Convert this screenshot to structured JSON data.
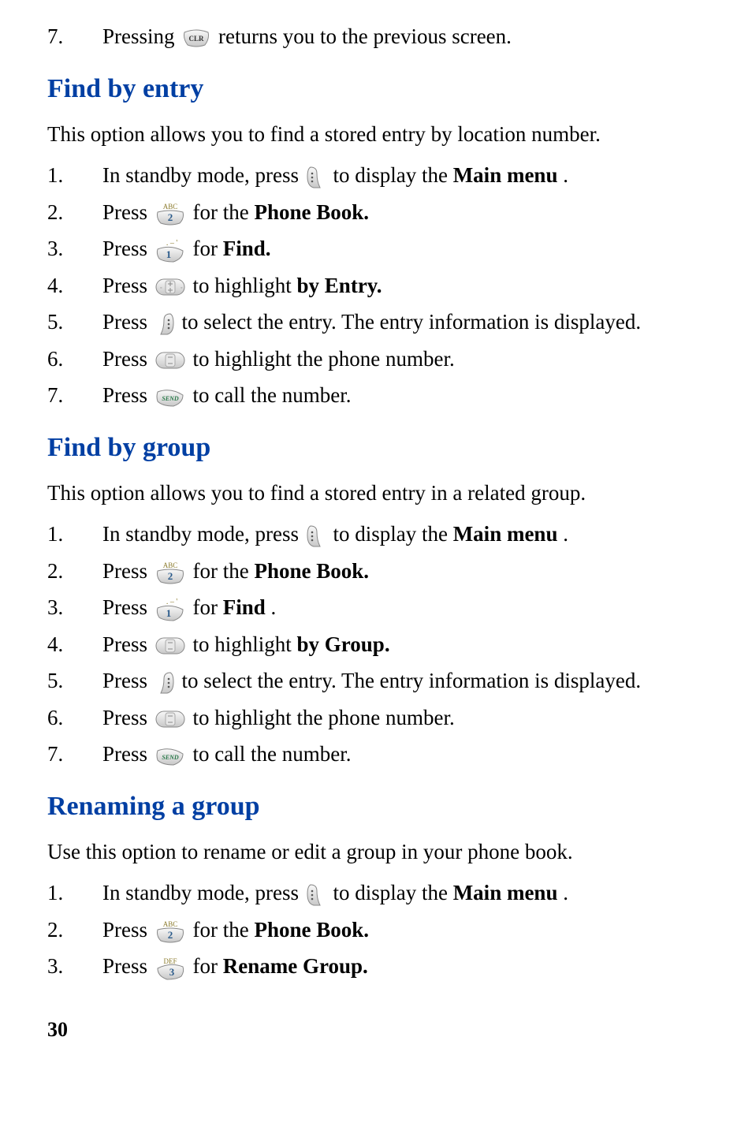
{
  "top_item": {
    "num": "7.",
    "t1": "Pressing ",
    "t2": " returns you to the previous screen."
  },
  "sections": {
    "findByEntry": {
      "heading": "Find by entry",
      "intro": "This option allows you to find a stored entry by location number.",
      "steps": [
        {
          "num": "1.",
          "t1": "In standby mode, press ",
          "t2": " to display the ",
          "bold": "Main menu",
          "t3": "."
        },
        {
          "num": "2.",
          "t1": "Press ",
          "t2": " for the ",
          "bold": "Phone Book."
        },
        {
          "num": "3.",
          "t1": "Press ",
          "t2": " for ",
          "bold": "Find."
        },
        {
          "num": "4.",
          "t1": "Press ",
          "t2": "to highlight ",
          "bold": "by Entry."
        },
        {
          "num": "5.",
          "t1": "Press ",
          "t2": " to select the entry. The entry information is displayed."
        },
        {
          "num": "6.",
          "t1": "Press ",
          "t2": "to highlight the phone number."
        },
        {
          "num": "7.",
          "t1": "Press ",
          "t2": " to call the number."
        }
      ]
    },
    "findByGroup": {
      "heading": "Find by group",
      "intro": "This option allows you to find a stored entry in a related group.",
      "steps": [
        {
          "num": "1.",
          "t1": "In standby mode, press ",
          "t2": " to display the ",
          "bold": "Main menu",
          "t3": "."
        },
        {
          "num": "2.",
          "t1": "Press ",
          "t2": " for the ",
          "bold": "Phone Book."
        },
        {
          "num": "3.",
          "t1": "Press ",
          "t2": " for ",
          "bold": "Find",
          "t3": "."
        },
        {
          "num": "4.",
          "t1": "Press ",
          "t2": "to highlight ",
          "bold": "by Group."
        },
        {
          "num": "5.",
          "t1": "Press ",
          "t2": " to select the entry. The entry information is displayed."
        },
        {
          "num": "6.",
          "t1": "Press ",
          "t2": "to highlight the phone number."
        },
        {
          "num": "7.",
          "t1": "Press ",
          "t2": " to call the number."
        }
      ]
    },
    "renameGroup": {
      "heading": "Renaming a group",
      "intro": "Use this option to rename or edit a group in your phone book.",
      "steps": [
        {
          "num": "1.",
          "t1": "In standby mode, press ",
          "t2": " to display the ",
          "bold": "Main menu",
          "t3": "."
        },
        {
          "num": "2.",
          "t1": "Press ",
          "t2": " for the ",
          "bold": "Phone Book."
        },
        {
          "num": "3.",
          "t1": "Press ",
          "t2": " for ",
          "bold": "Rename Group."
        }
      ]
    }
  },
  "pageNumber": "30"
}
